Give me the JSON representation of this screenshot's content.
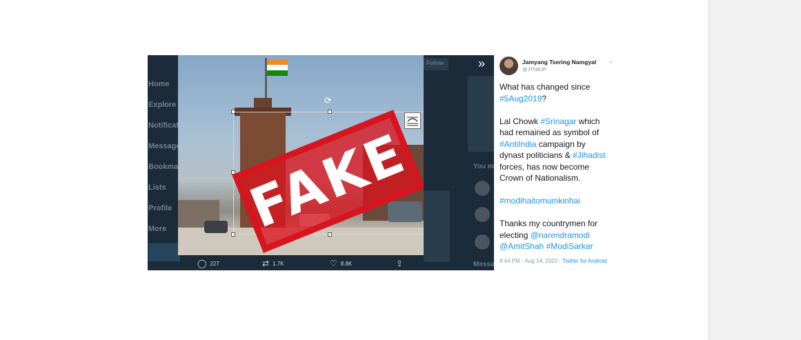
{
  "viewer": {
    "background_nav": [
      "Home",
      "Explore",
      "Notificati",
      "Messages",
      "Bookmark",
      "Lists",
      "Profile",
      "More"
    ],
    "background_labels": {
      "follow_button": "Follow",
      "you_might_like": "You m",
      "messages": "Messa"
    },
    "stamp_text": "FAKE",
    "actions": {
      "replies": "227",
      "retweets": "1.7K",
      "likes": "8.8K"
    }
  },
  "tweet": {
    "author_name": "Jamyang Tsering Namgyal",
    "author_handle": "@JTNBJP",
    "lines": [
      [
        "What has changed since"
      ],
      [
        {
          "t": "#5Aug2019",
          "link": true
        },
        {
          "t": "?"
        }
      ],
      [],
      [
        {
          "t": "Lal Chowk "
        },
        {
          "t": "#Srinagar",
          "link": true
        },
        {
          "t": " which"
        }
      ],
      [
        "had remained as symbol of"
      ],
      [
        {
          "t": "#AntiIndia",
          "link": true
        },
        {
          "t": " campaign by"
        }
      ],
      [
        {
          "t": "dynast politicians & "
        },
        {
          "t": "#Jihadist",
          "link": true
        }
      ],
      [
        "forces, has now become"
      ],
      [
        "Crown of Nationalism."
      ],
      [],
      [
        {
          "t": "#modihaitomumkinhai",
          "link": true
        }
      ],
      [],
      [
        "Thanks my countrymen for"
      ],
      [
        {
          "t": "electing "
        },
        {
          "t": "@narendramodi",
          "link": true
        }
      ],
      [
        {
          "t": "@AmitShah",
          "link": true
        },
        {
          "t": " "
        },
        {
          "t": "#ModiSarkar",
          "link": true
        }
      ]
    ],
    "timestamp": "8:44 PM · Aug 14, 2020 · ",
    "client": "Twitter for Android"
  },
  "colors": {
    "link": "#1b95e0",
    "stamp": "#d7151e",
    "viewer_bg": "#1b2b39"
  },
  "icons": [
    "expand-icon",
    "reply-icon",
    "retweet-icon",
    "like-icon",
    "share-icon",
    "rotate-icon",
    "layout-options-icon",
    "chevron-down-icon"
  ]
}
